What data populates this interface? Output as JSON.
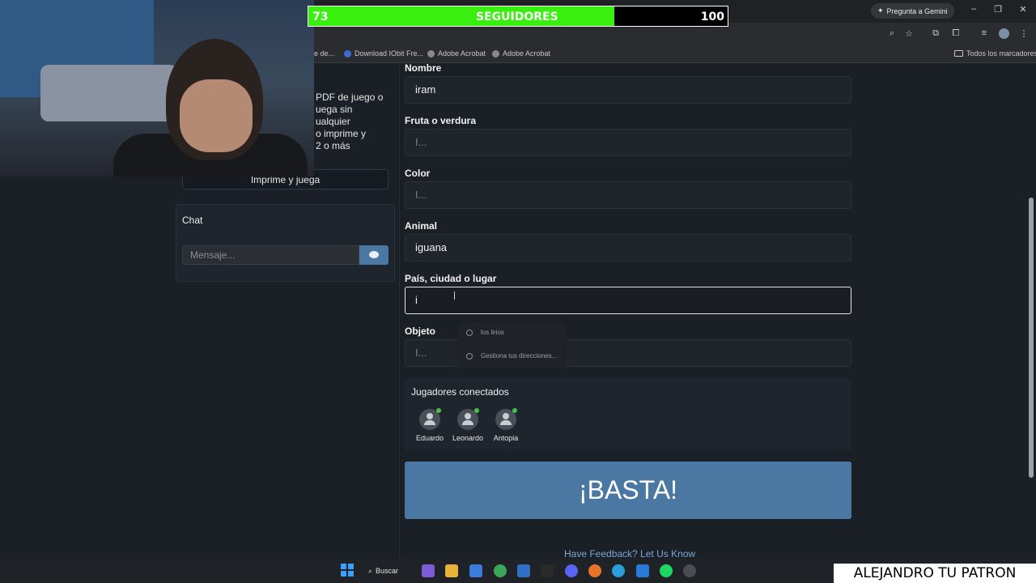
{
  "follower_bar": {
    "current": "73",
    "label": "SEGUIDORES",
    "goal": "100",
    "progress": 0.73,
    "fill_color": "#38ef0e"
  },
  "browser": {
    "gemini_button": "Pregunta a Gemini",
    "bookmarks": [
      {
        "label": "e de...",
        "icon": "bookmark-icon"
      },
      {
        "label": "Download IObit Fre...",
        "icon": "iobit-icon"
      },
      {
        "label": "Adobe Acrobat",
        "icon": "globe-icon"
      },
      {
        "label": "Adobe Acrobat",
        "icon": "globe-icon"
      }
    ],
    "all_bookmarks": "Todos los marcadores"
  },
  "sidebar": {
    "description_lines": [
      "PDF de juego o",
      "uega sin",
      "ualquier",
      "o imprime y",
      "2 o más"
    ],
    "print_button": "Imprime y juega",
    "chat_title": "Chat",
    "chat_placeholder": "Mensaje..."
  },
  "form": {
    "fields": [
      {
        "label": "Nombre",
        "value": "iram",
        "placeholder": ""
      },
      {
        "label": "Fruta o verdura",
        "value": "",
        "placeholder": "I..."
      },
      {
        "label": "Color",
        "value": "",
        "placeholder": "I..."
      },
      {
        "label": "Animal",
        "value": "iguana",
        "placeholder": ""
      },
      {
        "label": "País, ciudad o lugar",
        "value": "i",
        "placeholder": ""
      },
      {
        "label": "Objeto",
        "value": "",
        "placeholder": "I..."
      }
    ],
    "autocomplete": [
      "los lirios",
      "Gestiona tus direcciones..."
    ]
  },
  "players": {
    "title": "Jugadores conectados",
    "list": [
      "Eduardo",
      "Leonardo",
      "Antopia"
    ]
  },
  "basta_button": "¡BASTA!",
  "feedback_link": "Have Feedback? Let Us Know",
  "taskbar": {
    "search_label": "Buscar"
  },
  "watermark": "ALEJANDRO TU PATRON"
}
